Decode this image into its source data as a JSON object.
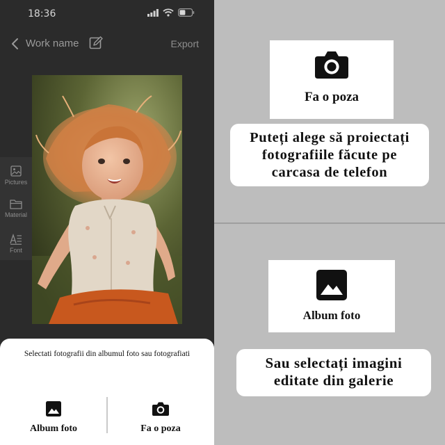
{
  "status_bar": {
    "time": "18:36"
  },
  "header": {
    "title": "Work name",
    "export_label": "Export"
  },
  "toolbar": {
    "items": [
      {
        "label": "Pictures",
        "icon": "image-icon"
      },
      {
        "label": "Material",
        "icon": "folder-icon"
      },
      {
        "label": "Font",
        "icon": "text-icon"
      }
    ]
  },
  "bottom_sheet": {
    "title": "Selectati fotografii din albumul foto sau fotografiati",
    "options": [
      {
        "label": "Album foto",
        "icon": "gallery-icon"
      },
      {
        "label": "Fa o poza",
        "icon": "camera-icon"
      }
    ]
  },
  "panels": {
    "top": {
      "card_label": "Fa o poza",
      "card_icon": "camera-icon",
      "caption_lines": [
        "Puteți alege să proiectați",
        "fotografiile făcute pe",
        "carcasa de telefon"
      ]
    },
    "bottom": {
      "card_label": "Album foto",
      "card_icon": "gallery-icon",
      "caption_lines": [
        "Sau selectați imagini",
        "editate din galerie"
      ]
    }
  },
  "colors": {
    "app_background": "#2b2b2b",
    "sheet_background": "#ffffff",
    "panel_background": "#bdbdbd"
  }
}
